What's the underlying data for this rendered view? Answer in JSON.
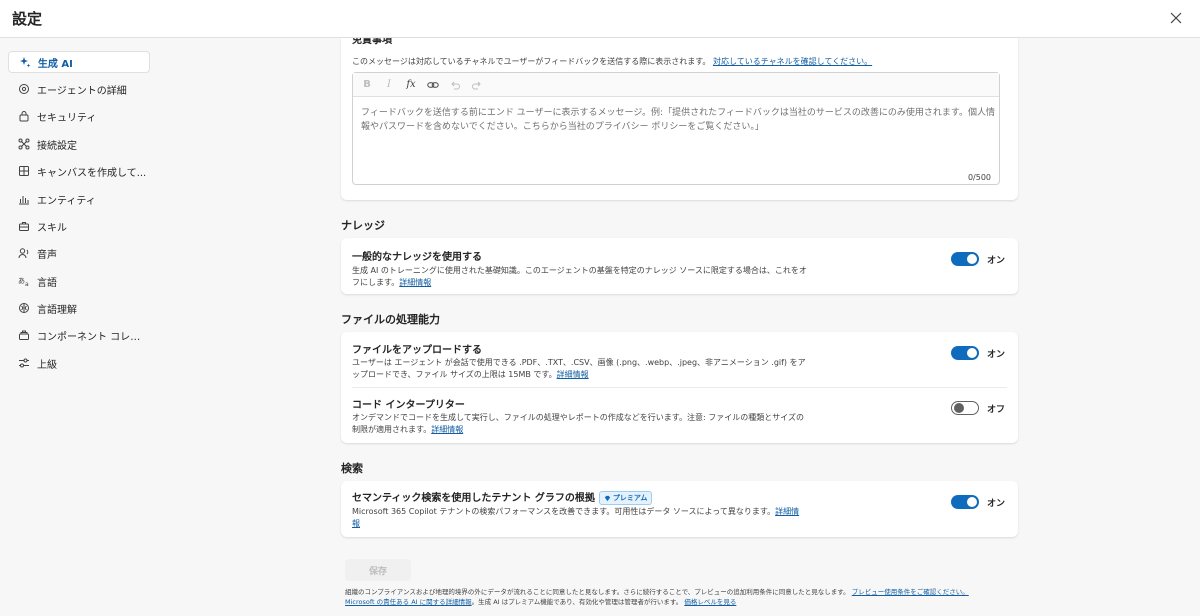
{
  "window": {
    "title": "設定"
  },
  "sidebar": {
    "items": [
      {
        "label": "生成 AI",
        "icon": "sparkle-icon",
        "active": true
      },
      {
        "label": "エージェントの詳細",
        "icon": "gear-icon"
      },
      {
        "label": "セキュリティ",
        "icon": "lock-icon"
      },
      {
        "label": "接続設定",
        "icon": "connection-icon"
      },
      {
        "label": "キャンバスを作成して...",
        "icon": "grid-icon"
      },
      {
        "label": "エンティティ",
        "icon": "entity-icon"
      },
      {
        "label": "スキル",
        "icon": "toolbox-icon"
      },
      {
        "label": "音声",
        "icon": "voice-icon"
      },
      {
        "label": "言語",
        "icon": "language-icon"
      },
      {
        "label": "言語理解",
        "icon": "brain-icon"
      },
      {
        "label": "コンポーネント コレク...",
        "icon": "component-icon"
      },
      {
        "label": "上級",
        "icon": "sliders-icon"
      }
    ]
  },
  "feedback": {
    "heading": "免責事項",
    "desc": "このメッセージは対応しているチャネルでユーザーがフィードバックを送信する際に表示されます。",
    "desc_link": "対応しているチャネルを確認してください。",
    "placeholder": "フィードバックを送信する前にエンド ユーザーに表示するメッセージ。例:「提供されたフィードバックは当社のサービスの改善にのみ使用されます。個人情報やパスワードを含めないでください。こちらから当社のプライバシー ポリシーをご覧ください。」",
    "counter": "0/500"
  },
  "knowledge": {
    "section": "ナレッジ",
    "title": "一般的なナレッジを使用する",
    "desc": "生成 AI のトレーニングに使用された基礎知識。このエージェントの基盤を特定のナレッジ ソースに限定する場合は、これをオフにします。",
    "link": "詳細情報",
    "toggle_label": "オン"
  },
  "files": {
    "section": "ファイルの処理能力",
    "upload_title": "ファイルをアップロードする",
    "upload_desc": "ユーザーは エージェント が会話で使用できる .PDF、.TXT、.CSV、画像 (.png、.webp、.jpeg、非アニメーション .gif) をアップロードでき、ファイル サイズの上限は 15MB です。",
    "upload_link": "詳細情報",
    "upload_toggle": "オン",
    "code_title": "コード インタープリター",
    "code_desc": "オンデマンドでコードを生成して実行し、ファイルの処理やレポートの作成などを行います。注意: ファイルの種類とサイズの制限が適用されます。",
    "code_link": "詳細情報",
    "code_toggle": "オフ"
  },
  "search": {
    "section": "検索",
    "title": "セマンティック検索を使用したテナント グラフの根拠",
    "badge": "プレミアム",
    "desc": "Microsoft 365 Copilot テナントの検索パフォーマンスを改善できます。可用性はデータ ソースによって異なります。",
    "link": "詳細情報",
    "toggle_label": "オン"
  },
  "save_label": "保存",
  "footer": {
    "text1": "組織のコンプライアンスおよび地理的境界の外にデータが流れることに同意したと見なします。さらに続行することで、プレビューの追加利用条件に同意したと見なします。",
    "link1": "プレビュー使用条件をご確認ください。",
    "link2": "Microsoft の責任ある AI に関する詳細情報",
    "text2": "。生成 AI はプレミアム機能であり、有効化や管理は管理者が行います。",
    "link3": "価格レベルを見る"
  },
  "colors": {
    "accent": "#0f6cbd",
    "link": "#115ea3"
  }
}
